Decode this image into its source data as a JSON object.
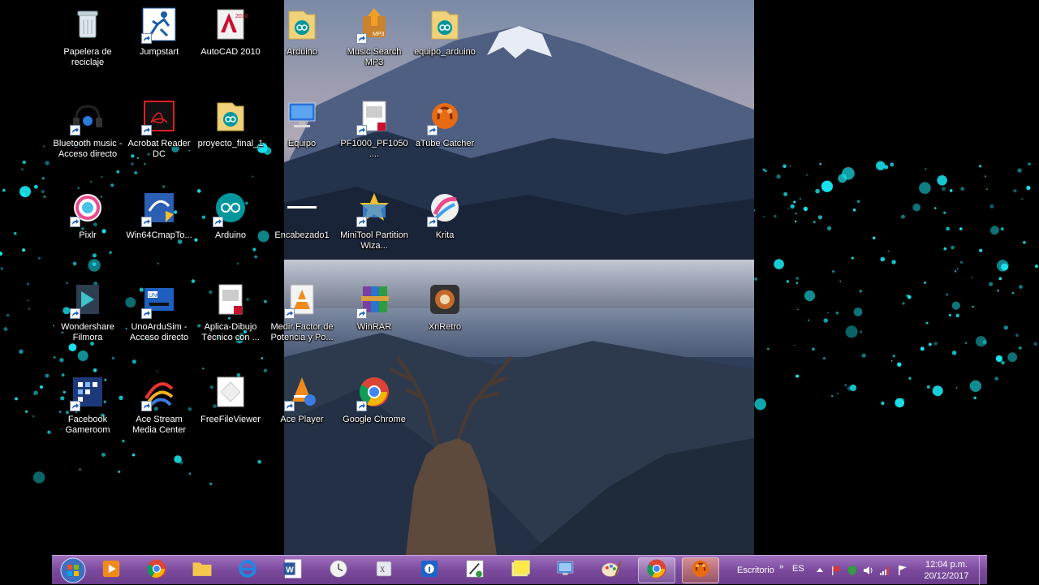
{
  "desktop_icons": [
    {
      "label": "Papelera de reciclaje",
      "icon": "recycle-bin-icon"
    },
    {
      "label": "Jumpstart",
      "icon": "jumpstart-icon"
    },
    {
      "label": "AutoCAD 2010",
      "icon": "autocad-icon"
    },
    {
      "label": "Arduino",
      "icon": "arduino-folder-icon"
    },
    {
      "label": "Music Search MP3",
      "icon": "music-search-icon"
    },
    {
      "label": "equipo_arduino",
      "icon": "arduino-folder-icon"
    },
    {
      "label": "Bluetooth music - Acceso directo",
      "icon": "bluetooth-music-icon"
    },
    {
      "label": "Acrobat Reader DC",
      "icon": "acrobat-icon"
    },
    {
      "label": "proyecto_final_1",
      "icon": "arduino-folder-icon"
    },
    {
      "label": "Equipo",
      "icon": "computer-icon"
    },
    {
      "label": "PF1000_PF1050....",
      "icon": "pdf-file-icon"
    },
    {
      "label": "aTube Catcher",
      "icon": "atube-catcher-icon"
    },
    {
      "label": "Pixlr",
      "icon": "pixlr-icon"
    },
    {
      "label": "Win64CmapTo...",
      "icon": "cmap-icon"
    },
    {
      "label": "Arduino",
      "icon": "arduino-app-icon"
    },
    {
      "label": "Encabezado1",
      "icon": "blank-file-icon"
    },
    {
      "label": "MiniTool Partition Wiza...",
      "icon": "minitool-icon"
    },
    {
      "label": "Krita",
      "icon": "krita-icon"
    },
    {
      "label": "Wondershare Filmora",
      "icon": "filmora-icon"
    },
    {
      "label": "UnoArduSim - Acceso directo",
      "icon": "unoardusim-icon"
    },
    {
      "label": "Aplica-Dibujo Técnico con ...",
      "icon": "pdf-file-icon"
    },
    {
      "label": "Medir Factor de Potencia y Po...",
      "icon": "vlc-file-icon"
    },
    {
      "label": "WinRAR",
      "icon": "winrar-icon"
    },
    {
      "label": "XnRetro",
      "icon": "xnretro-icon"
    },
    {
      "label": "Facebook Gameroom",
      "icon": "gameroom-icon"
    },
    {
      "label": "Ace Stream Media Center",
      "icon": "acestream-icon"
    },
    {
      "label": "FreeFileViewer",
      "icon": "freefileviewer-icon"
    },
    {
      "label": "Ace Player",
      "icon": "aceplayer-icon"
    },
    {
      "label": "Google Chrome",
      "icon": "chrome-icon"
    }
  ],
  "taskbar": {
    "pinned": [
      {
        "icon": "media-player-icon"
      },
      {
        "icon": "chrome-icon"
      },
      {
        "icon": "file-explorer-icon"
      },
      {
        "icon": "internet-explorer-icon"
      },
      {
        "icon": "word-icon"
      },
      {
        "icon": "clock-app-icon"
      },
      {
        "icon": "dictionary-icon"
      },
      {
        "icon": "info-app-icon"
      },
      {
        "icon": "shield-app-icon"
      },
      {
        "icon": "sticky-notes-icon"
      },
      {
        "icon": "remote-desktop-icon"
      },
      {
        "icon": "paint-icon"
      },
      {
        "icon": "chrome-icon"
      },
      {
        "icon": "atube-catcher-icon"
      }
    ],
    "toolbar_label": "Escritorio",
    "toolbar_chevron": "»",
    "language": "ES",
    "time": "12:04 p.m.",
    "date": "20/12/2017"
  },
  "colors": {
    "taskbar": "#7c4b9e",
    "particle": "#19e6f0"
  }
}
